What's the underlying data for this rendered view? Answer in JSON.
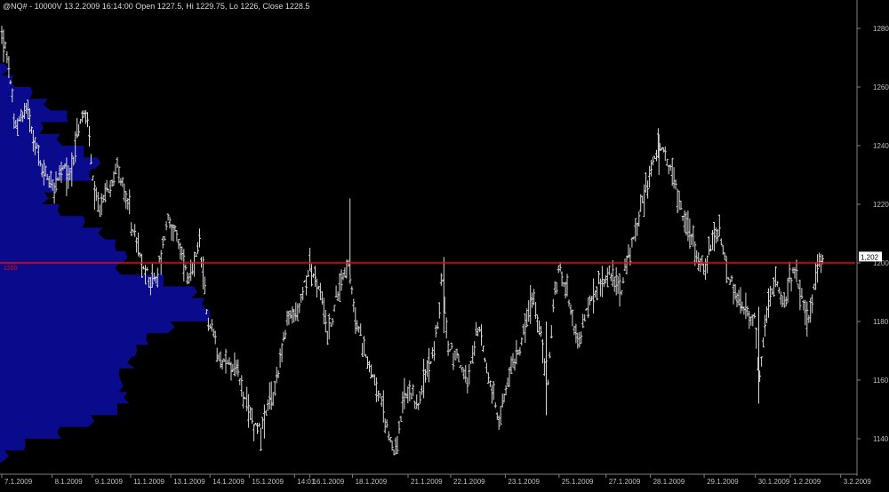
{
  "header": {
    "title": "@NQ# - 10000V 13.2.2009 16:14:00 Open 1227.5, Hi 1229.75, Lo 1226, Close 1228.5"
  },
  "colors": {
    "background": "#000000",
    "bars": "#d8d8d8",
    "profile": "#0a0a8c",
    "reference_line": "#ff0000",
    "axis": "#808080",
    "text": "#bfbfbf",
    "price_marker_bg": "#ffffff",
    "price_marker_text": "#000000"
  },
  "chart_data": {
    "type": "line",
    "subtype": "price-bars-with-volume-profile",
    "ylim": [
      1132,
      1284
    ],
    "yticks": [
      1140,
      1160,
      1180,
      1200,
      1220,
      1240,
      1260,
      1280
    ],
    "yticklabels": [
      "1140",
      "1160",
      "1180",
      "1200",
      "1220",
      "1240",
      "1260",
      "1280"
    ],
    "y_axis_position": "right",
    "grid": false,
    "x_date_labels": [
      "7.1.2009",
      "8.1.2009",
      "9.1.2009",
      "11.1.2009",
      "13.1.2009",
      "14.1.2009",
      "15.1.2009",
      "14:01",
      "16.1.2009",
      "18.1.2009",
      "21.1.2009",
      "22.1.2009",
      "23.1.2009",
      "25.1.2009",
      "27.1.2009",
      "28.1.2009",
      "29.1.2009",
      "30.1.2009",
      "1.2.2009",
      "3.2.2009"
    ],
    "x_date_positions": [
      0.0,
      0.059,
      0.106,
      0.151,
      0.198,
      0.244,
      0.29,
      0.343,
      0.361,
      0.411,
      0.476,
      0.526,
      0.59,
      0.653,
      0.708,
      0.76,
      0.823,
      0.883,
      0.924,
      0.983
    ],
    "reference_line": {
      "value": 1200,
      "label": "1200"
    },
    "last_price": {
      "value": 1202,
      "label": "1,202"
    },
    "price_path": [
      {
        "t": 0.0,
        "p": 1278
      },
      {
        "t": 0.008,
        "p": 1268
      },
      {
        "t": 0.015,
        "p": 1246
      },
      {
        "t": 0.03,
        "p": 1254
      },
      {
        "t": 0.045,
        "p": 1233
      },
      {
        "t": 0.062,
        "p": 1226
      },
      {
        "t": 0.072,
        "p": 1232
      },
      {
        "t": 0.08,
        "p": 1230
      },
      {
        "t": 0.09,
        "p": 1246
      },
      {
        "t": 0.1,
        "p": 1252
      },
      {
        "t": 0.108,
        "p": 1222
      },
      {
        "t": 0.115,
        "p": 1218
      },
      {
        "t": 0.135,
        "p": 1234
      },
      {
        "t": 0.15,
        "p": 1216
      },
      {
        "t": 0.165,
        "p": 1198
      },
      {
        "t": 0.18,
        "p": 1193
      },
      {
        "t": 0.195,
        "p": 1216
      },
      {
        "t": 0.21,
        "p": 1204
      },
      {
        "t": 0.22,
        "p": 1193
      },
      {
        "t": 0.232,
        "p": 1206
      },
      {
        "t": 0.24,
        "p": 1183
      },
      {
        "t": 0.258,
        "p": 1167
      },
      {
        "t": 0.275,
        "p": 1164
      },
      {
        "t": 0.29,
        "p": 1147
      },
      {
        "t": 0.305,
        "p": 1143
      },
      {
        "t": 0.32,
        "p": 1158
      },
      {
        "t": 0.335,
        "p": 1180
      },
      {
        "t": 0.348,
        "p": 1184
      },
      {
        "t": 0.36,
        "p": 1200
      },
      {
        "t": 0.372,
        "p": 1190
      },
      {
        "t": 0.383,
        "p": 1175
      },
      {
        "t": 0.395,
        "p": 1192
      },
      {
        "t": 0.405,
        "p": 1200
      },
      {
        "t": 0.415,
        "p": 1180
      },
      {
        "t": 0.428,
        "p": 1168
      },
      {
        "t": 0.44,
        "p": 1157
      },
      {
        "t": 0.455,
        "p": 1140
      },
      {
        "t": 0.462,
        "p": 1135
      },
      {
        "t": 0.472,
        "p": 1155
      },
      {
        "t": 0.488,
        "p": 1152
      },
      {
        "t": 0.5,
        "p": 1165
      },
      {
        "t": 0.51,
        "p": 1175
      },
      {
        "t": 0.516,
        "p": 1198
      },
      {
        "t": 0.522,
        "p": 1172
      },
      {
        "t": 0.535,
        "p": 1168
      },
      {
        "t": 0.545,
        "p": 1158
      },
      {
        "t": 0.558,
        "p": 1178
      },
      {
        "t": 0.57,
        "p": 1163
      },
      {
        "t": 0.582,
        "p": 1145
      },
      {
        "t": 0.595,
        "p": 1162
      },
      {
        "t": 0.61,
        "p": 1175
      },
      {
        "t": 0.622,
        "p": 1188
      },
      {
        "t": 0.632,
        "p": 1174
      },
      {
        "t": 0.64,
        "p": 1160
      },
      {
        "t": 0.648,
        "p": 1192
      },
      {
        "t": 0.655,
        "p": 1198
      },
      {
        "t": 0.665,
        "p": 1188
      },
      {
        "t": 0.675,
        "p": 1172
      },
      {
        "t": 0.688,
        "p": 1186
      },
      {
        "t": 0.7,
        "p": 1192
      },
      {
        "t": 0.712,
        "p": 1198
      },
      {
        "t": 0.725,
        "p": 1190
      },
      {
        "t": 0.733,
        "p": 1200
      },
      {
        "t": 0.745,
        "p": 1214
      },
      {
        "t": 0.757,
        "p": 1228
      },
      {
        "t": 0.769,
        "p": 1240
      },
      {
        "t": 0.778,
        "p": 1236
      },
      {
        "t": 0.788,
        "p": 1228
      },
      {
        "t": 0.8,
        "p": 1214
      },
      {
        "t": 0.812,
        "p": 1206
      },
      {
        "t": 0.822,
        "p": 1198
      },
      {
        "t": 0.832,
        "p": 1205
      },
      {
        "t": 0.84,
        "p": 1212
      },
      {
        "t": 0.85,
        "p": 1196
      },
      {
        "t": 0.862,
        "p": 1188
      },
      {
        "t": 0.872,
        "p": 1183
      },
      {
        "t": 0.883,
        "p": 1180
      },
      {
        "t": 0.888,
        "p": 1160
      },
      {
        "t": 0.897,
        "p": 1186
      },
      {
        "t": 0.908,
        "p": 1192
      },
      {
        "t": 0.918,
        "p": 1186
      },
      {
        "t": 0.928,
        "p": 1198
      },
      {
        "t": 0.938,
        "p": 1188
      },
      {
        "t": 0.947,
        "p": 1180
      },
      {
        "t": 0.955,
        "p": 1198
      },
      {
        "t": 0.962,
        "p": 1202
      }
    ],
    "volume_profile": [
      {
        "price": 1134,
        "volume": 3
      },
      {
        "price": 1138,
        "volume": 12
      },
      {
        "price": 1142,
        "volume": 28
      },
      {
        "price": 1146,
        "volume": 44
      },
      {
        "price": 1150,
        "volume": 56
      },
      {
        "price": 1154,
        "volume": 60
      },
      {
        "price": 1158,
        "volume": 58
      },
      {
        "price": 1162,
        "volume": 57
      },
      {
        "price": 1166,
        "volume": 62
      },
      {
        "price": 1170,
        "volume": 65
      },
      {
        "price": 1174,
        "volume": 70
      },
      {
        "price": 1178,
        "volume": 82
      },
      {
        "price": 1182,
        "volume": 100
      },
      {
        "price": 1186,
        "volume": 97
      },
      {
        "price": 1190,
        "volume": 93
      },
      {
        "price": 1194,
        "volume": 78
      },
      {
        "price": 1198,
        "volume": 56
      },
      {
        "price": 1202,
        "volume": 60
      },
      {
        "price": 1206,
        "volume": 55
      },
      {
        "price": 1210,
        "volume": 48
      },
      {
        "price": 1214,
        "volume": 40
      },
      {
        "price": 1218,
        "volume": 28
      },
      {
        "price": 1222,
        "volume": 22
      },
      {
        "price": 1226,
        "volume": 26
      },
      {
        "price": 1230,
        "volume": 43
      },
      {
        "price": 1234,
        "volume": 47
      },
      {
        "price": 1238,
        "volume": 40
      },
      {
        "price": 1242,
        "volume": 28
      },
      {
        "price": 1246,
        "volume": 20
      },
      {
        "price": 1250,
        "volume": 32
      },
      {
        "price": 1254,
        "volume": 22
      },
      {
        "price": 1258,
        "volume": 15
      },
      {
        "price": 1262,
        "volume": 6
      },
      {
        "price": 1266,
        "volume": 3
      }
    ]
  }
}
